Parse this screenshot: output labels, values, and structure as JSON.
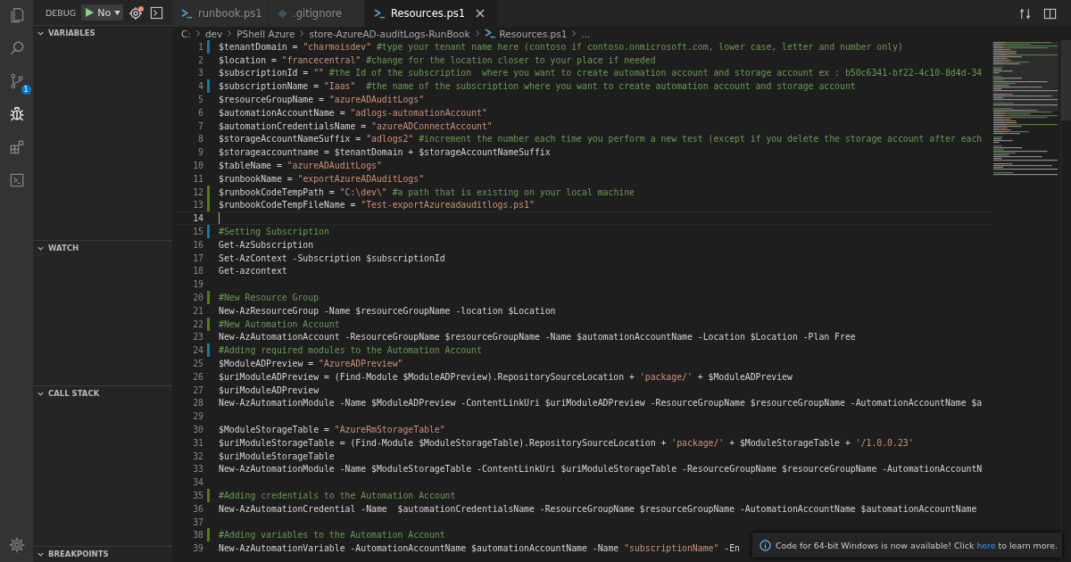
{
  "activity_bar": {
    "items": [
      {
        "kind": "files",
        "selected": false
      },
      {
        "kind": "search",
        "selected": false
      },
      {
        "kind": "source-control",
        "selected": false,
        "badge": "1"
      },
      {
        "kind": "debug",
        "selected": true
      },
      {
        "kind": "extensions",
        "selected": false
      },
      {
        "kind": "terminal",
        "selected": false
      }
    ],
    "bottom": [
      {
        "kind": "settings",
        "selected": false
      }
    ]
  },
  "debug_toolbar": {
    "label": "DEBUG",
    "configuration": "No"
  },
  "sidebar_sections": [
    {
      "title": "VARIABLES",
      "expanded": true
    },
    {
      "title": "WATCH",
      "expanded": true
    },
    {
      "title": "CALL STACK",
      "expanded": true
    },
    {
      "title": "BREAKPOINTS",
      "expanded": true
    }
  ],
  "tabs": [
    {
      "label": "runbook.ps1",
      "kind": "powershell",
      "selected": false
    },
    {
      "label": ".gitignore",
      "kind": "git",
      "selected": false
    },
    {
      "label": "Resources.ps1",
      "kind": "powershell",
      "selected": true
    }
  ],
  "breadcrumb": [
    {
      "label": "C:",
      "kind": "folder"
    },
    {
      "label": "dev",
      "kind": "folder"
    },
    {
      "label": "PShell Azure",
      "kind": "folder"
    },
    {
      "label": "store-AzureAD-auditLogs-RunBook",
      "kind": "folder"
    },
    {
      "label": "Resources.ps1",
      "kind": "file"
    },
    {
      "label": "...",
      "kind": "folder"
    }
  ],
  "editor": {
    "lines": [
      {
        "number": "1",
        "modified": true,
        "added": false,
        "current": false,
        "segments": [
          {
            "kind": "code",
            "text": "$tenantDomain = "
          },
          {
            "kind": "string",
            "text": "\"charmoisdev\""
          },
          {
            "kind": "comment",
            "text": " #type your tenant name here (contoso if contoso.onmicrosoft.com, lower case, letter and number only)"
          }
        ]
      },
      {
        "number": "2",
        "modified": false,
        "added": false,
        "current": false,
        "segments": [
          {
            "kind": "code",
            "text": "$location = "
          },
          {
            "kind": "string",
            "text": "\"francecentral\""
          },
          {
            "kind": "comment",
            "text": " #change for the location closer to your place if needed"
          }
        ]
      },
      {
        "number": "3",
        "modified": false,
        "added": false,
        "current": false,
        "segments": [
          {
            "kind": "code",
            "text": "$subscriptionId = "
          },
          {
            "kind": "string",
            "text": "\"\""
          },
          {
            "kind": "comment",
            "text": " #the Id of the subscription  where you want to create automation account and storage account ex : b50c6341-bf22-4c10-8d4d-34"
          }
        ]
      },
      {
        "number": "4",
        "modified": true,
        "added": false,
        "current": false,
        "segments": [
          {
            "kind": "code",
            "text": "$subscriptionName = "
          },
          {
            "kind": "string",
            "text": "\"Iaas\""
          },
          {
            "kind": "comment",
            "text": "  #the name of the subscription where you want to create automation account and storage account"
          }
        ]
      },
      {
        "number": "5",
        "modified": false,
        "added": false,
        "current": false,
        "segments": [
          {
            "kind": "code",
            "text": "$resourceGroupName = "
          },
          {
            "kind": "string",
            "text": "\"azureADAuditLogs\""
          }
        ]
      },
      {
        "number": "6",
        "modified": false,
        "added": false,
        "current": false,
        "segments": [
          {
            "kind": "code",
            "text": "$automationAccountName = "
          },
          {
            "kind": "string",
            "text": "\"adlogs-automationAccount\""
          }
        ]
      },
      {
        "number": "7",
        "modified": false,
        "added": false,
        "current": false,
        "segments": [
          {
            "kind": "code",
            "text": "$automationCredentialsName = "
          },
          {
            "kind": "string",
            "text": "\"azureADConnectAccount\""
          }
        ]
      },
      {
        "number": "8",
        "modified": false,
        "added": false,
        "current": false,
        "segments": [
          {
            "kind": "code",
            "text": "$storageAccountNameSuffix = "
          },
          {
            "kind": "string",
            "text": "\"adlogs2\""
          },
          {
            "kind": "comment",
            "text": " #increment the number each time you perform a new test (except if you delete the storage account after each"
          }
        ]
      },
      {
        "number": "9",
        "modified": false,
        "added": false,
        "current": false,
        "segments": [
          {
            "kind": "code",
            "text": "$storageaccountname = $tenantDomain + $storageAccountNameSuffix"
          }
        ]
      },
      {
        "number": "10",
        "modified": false,
        "added": false,
        "current": false,
        "segments": [
          {
            "kind": "code",
            "text": "$tableName = "
          },
          {
            "kind": "string",
            "text": "\"azureADAuditLogs\""
          }
        ]
      },
      {
        "number": "11",
        "modified": false,
        "added": false,
        "current": false,
        "segments": [
          {
            "kind": "code",
            "text": "$runbookName = "
          },
          {
            "kind": "string",
            "text": "\"exportAzureADAuditLogs\""
          }
        ]
      },
      {
        "number": "12",
        "modified": false,
        "added": true,
        "current": false,
        "segments": [
          {
            "kind": "code",
            "text": "$runbookCodeTempPath = "
          },
          {
            "kind": "string",
            "text": "\"C:\\dev\\\""
          },
          {
            "kind": "comment",
            "text": " #a path that is existing on your local machine"
          }
        ]
      },
      {
        "number": "13",
        "modified": false,
        "added": true,
        "current": false,
        "segments": [
          {
            "kind": "code",
            "text": "$runbookCodeTempFileName = "
          },
          {
            "kind": "string",
            "text": "\"Test-exportAzureadauditlogs.ps1\""
          }
        ]
      },
      {
        "number": "14",
        "modified": false,
        "added": false,
        "current": true
      },
      {
        "number": "15",
        "modified": true,
        "added": false,
        "current": false,
        "segments": [
          {
            "kind": "comment",
            "text": "#Setting Subscription"
          }
        ]
      },
      {
        "number": "16",
        "modified": false,
        "added": false,
        "current": false,
        "segments": [
          {
            "kind": "code",
            "text": "Get-AzSubscription"
          }
        ]
      },
      {
        "number": "17",
        "modified": false,
        "added": false,
        "current": false,
        "segments": [
          {
            "kind": "code",
            "text": "Set-AzContext -Subscription $subscriptionId"
          }
        ]
      },
      {
        "number": "18",
        "modified": false,
        "added": false,
        "current": false,
        "segments": [
          {
            "kind": "code",
            "text": "Get-azcontext"
          }
        ]
      },
      {
        "number": "19",
        "modified": false,
        "added": false,
        "current": false
      },
      {
        "number": "20",
        "modified": false,
        "added": true,
        "current": false,
        "segments": [
          {
            "kind": "comment",
            "text": "#New Resource Group"
          }
        ]
      },
      {
        "number": "21",
        "modified": false,
        "added": false,
        "current": false,
        "segments": [
          {
            "kind": "code",
            "text": "New-AzResourceGroup -Name $resourceGroupName -location $Location"
          }
        ]
      },
      {
        "number": "22",
        "modified": false,
        "added": true,
        "current": false,
        "segments": [
          {
            "kind": "comment",
            "text": "#New Automation Account"
          }
        ]
      },
      {
        "number": "23",
        "modified": false,
        "added": false,
        "current": false,
        "segments": [
          {
            "kind": "code",
            "text": "New-AzAutomationAccount -ResourceGroupName $resourceGroupName -Name $automationAccountName -Location $Location -Plan Free"
          }
        ]
      },
      {
        "number": "24",
        "modified": true,
        "added": false,
        "current": false,
        "segments": [
          {
            "kind": "comment",
            "text": "#Adding required modules to the Automation Account"
          }
        ]
      },
      {
        "number": "25",
        "modified": false,
        "added": false,
        "current": false,
        "segments": [
          {
            "kind": "code",
            "text": "$ModuleADPreview = "
          },
          {
            "kind": "string",
            "text": "\"AzureADPreview\""
          }
        ]
      },
      {
        "number": "26",
        "modified": false,
        "added": false,
        "current": false,
        "segments": [
          {
            "kind": "code",
            "text": "$uriModuleADPreview = (Find-Module $ModuleADPreview).RepositorySourceLocation + "
          },
          {
            "kind": "string",
            "text": "'package/'"
          },
          {
            "kind": "code",
            "text": " + $ModuleADPreview"
          }
        ]
      },
      {
        "number": "27",
        "modified": false,
        "added": false,
        "current": false,
        "segments": [
          {
            "kind": "code",
            "text": "$uriModuleADPreview"
          }
        ]
      },
      {
        "number": "28",
        "modified": false,
        "added": false,
        "current": false,
        "segments": [
          {
            "kind": "code",
            "text": "New-AzAutomationModule -Name $ModuleADPreview -ContentLinkUri $uriModuleADPreview -ResourceGroupName $resourceGroupName -AutomationAccountName $a"
          }
        ]
      },
      {
        "number": "29",
        "modified": false,
        "added": false,
        "current": false
      },
      {
        "number": "30",
        "modified": false,
        "added": false,
        "current": false,
        "segments": [
          {
            "kind": "code",
            "text": "$ModuleStorageTable = "
          },
          {
            "kind": "string",
            "text": "\"AzureRmStorageTable\""
          }
        ]
      },
      {
        "number": "31",
        "modified": false,
        "added": false,
        "current": false,
        "segments": [
          {
            "kind": "code",
            "text": "$uriModuleStorageTable = (Find-Module $ModuleStorageTable).RepositorySourceLocation + "
          },
          {
            "kind": "string",
            "text": "'package/'"
          },
          {
            "kind": "code",
            "text": " + $ModuleStorageTable + "
          },
          {
            "kind": "string",
            "text": "'/1.0.0.23'"
          }
        ]
      },
      {
        "number": "32",
        "modified": false,
        "added": false,
        "current": false,
        "segments": [
          {
            "kind": "code",
            "text": "$uriModuleStorageTable"
          }
        ]
      },
      {
        "number": "33",
        "modified": false,
        "added": false,
        "current": false,
        "segments": [
          {
            "kind": "code",
            "text": "New-AzAutomationModule -Name $ModuleStorageTable -ContentLinkUri $uriModuleStorageTable -ResourceGroupName $resourceGroupName -AutomationAccountN"
          }
        ]
      },
      {
        "number": "34",
        "modified": false,
        "added": false,
        "current": false
      },
      {
        "number": "35",
        "modified": false,
        "added": true,
        "current": false,
        "segments": [
          {
            "kind": "comment",
            "text": "#Adding credentials to the Automation Account"
          }
        ]
      },
      {
        "number": "36",
        "modified": false,
        "added": false,
        "current": false,
        "segments": [
          {
            "kind": "code",
            "text": "New-AzAutomationCredential -Name  $automationCredentialsName -ResourceGroupName $resourceGroupName -AutomationAccountName $automationAccountName"
          }
        ]
      },
      {
        "number": "37",
        "modified": false,
        "added": false,
        "current": false
      },
      {
        "number": "38",
        "modified": false,
        "added": true,
        "current": false,
        "segments": [
          {
            "kind": "comment",
            "text": "#Adding variables to the Automation Account"
          }
        ]
      },
      {
        "number": "39",
        "modified": false,
        "added": false,
        "current": false,
        "segments": [
          {
            "kind": "code",
            "text": "New-AzAutomationVariable -AutomationAccountName $automationAccountName -Name "
          },
          {
            "kind": "string",
            "text": "\"subscriptionName\""
          },
          {
            "kind": "code",
            "text": " -En"
          }
        ]
      }
    ]
  },
  "notification": {
    "text": "Code for 64-bit Windows is now available! Click",
    "link": "here",
    "text_after": "to learn more."
  }
}
